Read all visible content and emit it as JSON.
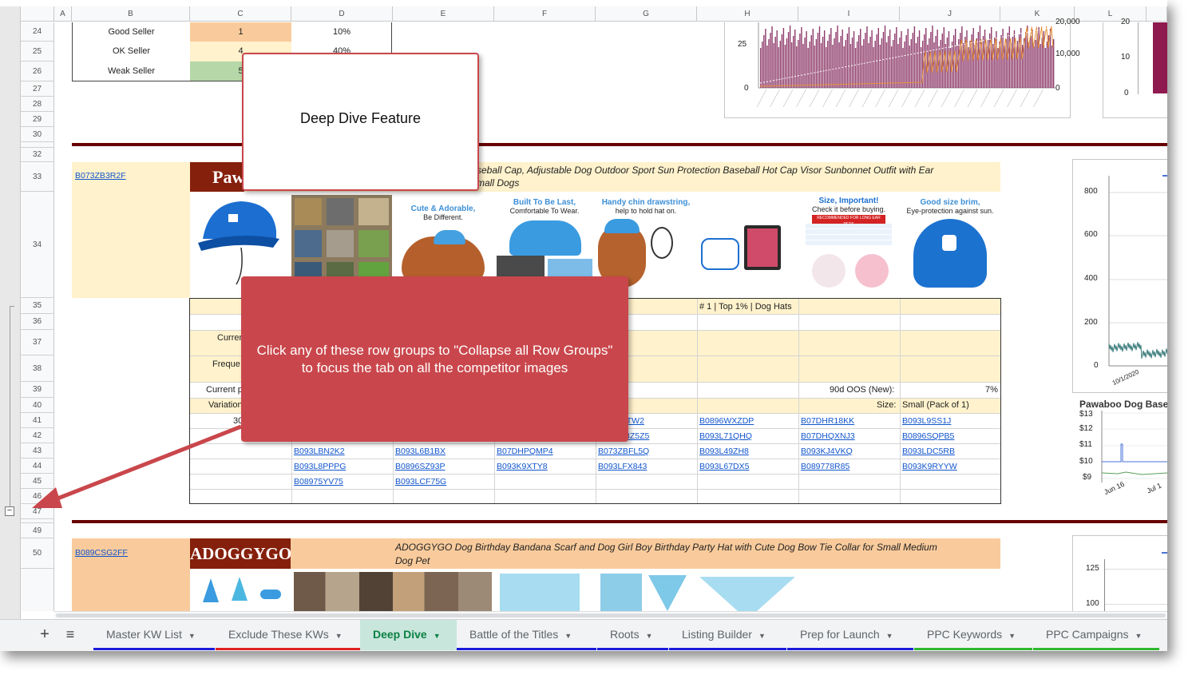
{
  "columns": [
    "A",
    "B",
    "C",
    "D",
    "E",
    "F",
    "G",
    "H",
    "I",
    "J",
    "K",
    "L"
  ],
  "rows": {
    "r24": "24",
    "r25": "25",
    "r26": "26",
    "r27": "27",
    "r28": "28",
    "r29": "29",
    "r30": "30",
    "r32": "32",
    "r33": "33",
    "r34": "34",
    "r35": "35",
    "r36": "36",
    "r37": "37",
    "r38": "38",
    "r39": "39",
    "r40": "40",
    "r41": "41",
    "r42": "42",
    "r43": "43",
    "r44": "44",
    "r45": "45",
    "r46": "46",
    "r47": "47",
    "r49": "49",
    "r50": "50"
  },
  "seller_table": {
    "good_label": "Good Seller",
    "good_count": "1",
    "good_pct": "10%",
    "ok_label": "OK Seller",
    "ok_count": "4",
    "ok_pct": "40%",
    "weak_label": "Weak Seller",
    "weak_count": "5"
  },
  "chart1": {
    "y1": "25",
    "y0": "0",
    "r1": "20,000",
    "r2": "10,000",
    "r0": "0"
  },
  "chart2": {
    "y1": "20",
    "y2": "10",
    "y0": "0"
  },
  "chart3": {
    "t800": "800",
    "t600": "600",
    "t400": "400",
    "t200": "200",
    "t0": "0",
    "xdate": "10/1/2020"
  },
  "chart4": {
    "title": "Pawaboo Dog Baseb",
    "p13": "$13",
    "p12": "$12",
    "p11": "$11",
    "p10": "$10",
    "p9": "$9",
    "x1": "Jun 16",
    "x2": "Jul 1"
  },
  "chart5": {
    "t125": "125",
    "t100": "100"
  },
  "product1": {
    "asin": "B073ZB3R2F",
    "brand": "Paw",
    "title1": "seball Cap, Adjustable Dog Outdoor Sport Sun Protection Baseball Hot Cap Visor Sunbonnet Outfit with Ear",
    "title2": "mall Dogs",
    "img_a1": "Cute & Adorable,",
    "img_a2": "Be Different.",
    "img_b1": "Built To Be Last,",
    "img_b2": "Comfortable To Wear.",
    "img_c1": "Handy chin drawstring,",
    "img_c2": "help to hold hat on.",
    "img_d1": "Size, Important!",
    "img_d2": "Check it before buying.",
    "img_d3": "RECOMMENDED FOR LONG EAR PETS",
    "img_e1": "Good size brim,",
    "img_e2": "Eye-protection against sun.",
    "rank": "# 1 | Top 1% | Dog Hats",
    "lbl_curr": "Curren",
    "lbl_freq": "Freque",
    "lbl_curp": "Current p",
    "lbl_var": "Variation",
    "lbl_30": "30",
    "oos": "90d OOS (New):",
    "oos_val": "7%",
    "size": "Size:",
    "size_val": "Small (Pack of 1)"
  },
  "asins": {
    "r41_g": "MTW2",
    "r41_h": "B0896WXZDP",
    "r41_i": "B07DHR18KK",
    "r41_j": "B093L9SS1J",
    "r42_g": "8Z5Z5",
    "r42_h": "B093L71QHQ",
    "r42_i": "B07DHQXNJ3",
    "r42_j": "B0896SQPB5",
    "r43_d": "B093LBN2K2",
    "r43_e": "B093L6B1BX",
    "r43_f": "B07DHPQMP4",
    "r43_g": "B073ZBFL5Q",
    "r43_h": "B093L49ZH8",
    "r43_i": "B093KJ4VKQ",
    "r43_j": "B093LDC5RB",
    "r44_d": "B093L8PPPG",
    "r44_e": "B0896SZ93P",
    "r44_f": "B093K9XTY8",
    "r44_g": "B093LFX843",
    "r44_h": "B093L67DX5",
    "r44_i": "B089778R85",
    "r44_j": "B093K9RYYW",
    "r45_d": "B08975YV75",
    "r45_e": "B093LCF75G"
  },
  "product2": {
    "asin": "B089CSG2FF",
    "brand": "ADOGGYGO",
    "title1": "ADOGGYGO Dog Birthday Bandana Scarf and Dog Girl Boy Birthday Party Hat with Cute Dog Bow Tie Collar for Small Medium",
    "title2": "Dog Pet"
  },
  "callouts": {
    "top": "Deep Dive Feature",
    "middle": "Click any of these row groups to \"Collapse all Row Groups\" to focus the tab on all the competitor images"
  },
  "tabs": {
    "add": "+",
    "list": "≡",
    "t1": "Master KW List",
    "t2": "Exclude These KWs",
    "t3": "Deep Dive",
    "t4": "Battle of the Titles",
    "t5": "Roots",
    "t6": "Listing Builder",
    "t7": "Prep for Launch",
    "t8": "PPC Keywords",
    "t9": "PPC Campaigns",
    "arrow": "▼"
  },
  "colors": {
    "orange_cell": "#f9cb9c",
    "yellow_cell": "#fff2cc",
    "green_cell": "#b6d7a8",
    "brand_bg": "#85200c",
    "title_bg_1": "#fff2cc",
    "title_bg_2": "#f9cb9c",
    "divider": "#660000",
    "callout": "#c9474c",
    "chart_bar": "#8e3a6a",
    "chart_line": "#e69138",
    "tab_blue": "#1a1adb",
    "tab_red": "#e02020",
    "tab_green": "#2eb82e",
    "active_tab": "#c9e6dd"
  }
}
